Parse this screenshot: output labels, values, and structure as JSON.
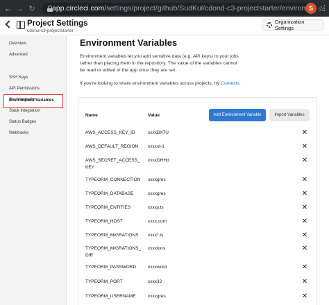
{
  "browser": {
    "url_host": "app.circleci.com",
    "url_path": "/settings/project/github/SudKul/cdond-c3-projectstarter/environment-variable...",
    "profile_initial": "S"
  },
  "header": {
    "title": "Project Settings",
    "subtitle": "cdond-c3-projectstarter",
    "org_settings_label": "Organization Settings"
  },
  "sidebar": {
    "items": [
      {
        "label": "Overview"
      },
      {
        "label": "Advanced"
      },
      {
        "label": "Environment Variables"
      },
      {
        "label": "SSH Keys"
      },
      {
        "label": "API Permissions"
      },
      {
        "label": "Jira Integration"
      },
      {
        "label": "Slack Integration"
      },
      {
        "label": "Status Badges"
      },
      {
        "label": "Webhooks"
      }
    ],
    "active_index": 2
  },
  "main": {
    "title": "Environment Variables",
    "description": "Environment variables let you add sensitive data (e.g. API keys) to your jobs rather than placing them in the repository. The value of the variables cannot be read or edited in the app once they are set.",
    "share_text": "If you're looking to share environment variables across projects, try",
    "share_link": "Contexts",
    "share_end": "."
  },
  "table": {
    "col_name": "Name",
    "col_value": "Value",
    "add_button": "Add Environment Variable",
    "import_button": "Import Variables",
    "delete_glyph": "✕",
    "rows": [
      {
        "name": "AWS_ACCESS_KEY_ID",
        "value": "xxxxBX7U"
      },
      {
        "name": "AWS_DEFAULT_REGION",
        "value": "xxxxst-1"
      },
      {
        "name": "AWS_SECRET_ACCESS_KEY",
        "value": "xxxxDHHd"
      },
      {
        "name": "TYPEORM_CONNECTION",
        "value": "xxxxgres"
      },
      {
        "name": "TYPEORM_DATABASE",
        "value": "xxxxgres"
      },
      {
        "name": "TYPEORM_ENTITIES",
        "value": "xxxxy.ts"
      },
      {
        "name": "TYPEORM_HOST",
        "value": "xxxx.com"
      },
      {
        "name": "TYPEORM_MIGRATIONS",
        "value": "xxxx*.ts"
      },
      {
        "name": "TYPEORM_MIGRATIONS_DIR",
        "value": "xxxxions"
      },
      {
        "name": "TYPEORM_PASSWORD",
        "value": "xxxxword"
      },
      {
        "name": "TYPEORM_PORT",
        "value": "xxxx32"
      },
      {
        "name": "TYPEORM_USERNAME",
        "value": "xxxxgres"
      }
    ]
  }
}
